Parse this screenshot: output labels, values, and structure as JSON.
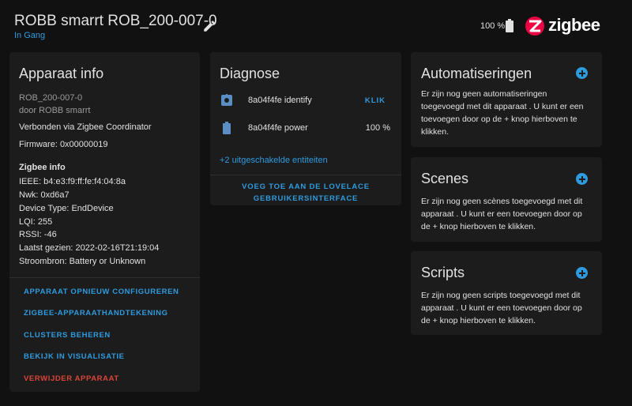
{
  "header": {
    "title": "ROBB smarrt ROB_200-007-0",
    "status": "In Gang",
    "battery": "100 %",
    "logo_text": "zigbee"
  },
  "info_card": {
    "title": "Apparaat info",
    "model": "ROB_200-007-0",
    "manufacturer": "door ROBB smarrt",
    "connected": "Verbonden via Zigbee Coordinator",
    "firmware": "Firmware: 0x00000019",
    "zigbee_heading": "Zigbee info",
    "ieee": "IEEE: b4:e3:f9:ff:fe:f4:04:8a",
    "nwk": "Nwk: 0xd6a7",
    "device_type": "Device Type: EndDevice",
    "lqi": "LQI: 255",
    "rssi": "RSSI: -46",
    "last_seen": "Laatst gezien: 2022-02-16T21:19:04",
    "power_source": "Stroombron: Battery or Unknown",
    "actions": {
      "reconfigure": "APPARAAT OPNIEUW CONFIGUREREN",
      "signature": "ZIGBEE-APPARAATHANDTEKENING",
      "clusters": "CLUSTERS BEHEREN",
      "visualize": "BEKIJK IN VISUALISATIE",
      "delete": "VERWIJDER APPARAAT"
    }
  },
  "diag_card": {
    "title": "Diagnose",
    "entities": [
      {
        "name": "8a04f4fe identify",
        "action": "KLIK",
        "icon": "identify-icon"
      },
      {
        "name": "8a04f4fe power",
        "value": "100 %",
        "icon": "battery-icon"
      }
    ],
    "disabled_link": "+2 uitgeschakelde entiteiten",
    "lovelace_line1": "VOEG TOE AAN DE LOVELACE",
    "lovelace_line2": "GEBRUIKERSINTERFACE"
  },
  "automations_card": {
    "title": "Automatiseringen",
    "text": "Er zijn nog geen automatiseringen toegevoegd met dit apparaat . U kunt er een toevoegen door op de + knop hierboven te klikken."
  },
  "scenes_card": {
    "title": "Scenes",
    "text": "Er zijn nog geen scènes toegevoegd met dit apparaat . U kunt er een toevoegen door op de + knop hierboven te klikken."
  },
  "scripts_card": {
    "title": "Scripts",
    "text": "Er zijn nog geen scripts toegevoegd met dit apparaat . U kunt er een toevoegen door op de + knop hierboven te klikken."
  },
  "colors": {
    "accent": "#2f9bdf",
    "danger": "#db4437",
    "logo_red": "#eb0443",
    "card_bg": "#1c1c1c",
    "page_bg": "#111111"
  }
}
